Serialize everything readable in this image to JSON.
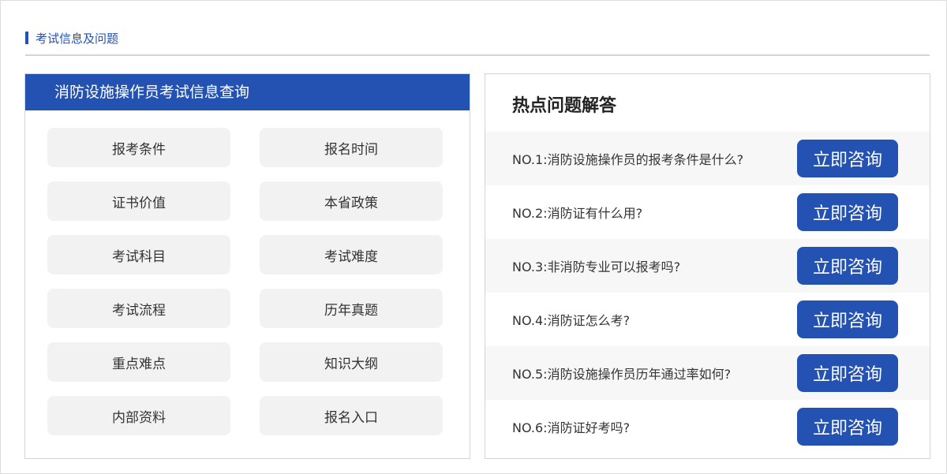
{
  "section": {
    "title": "考试信息及问题"
  },
  "left_panel": {
    "header": "消防设施操作员考试信息查询",
    "buttons": [
      "报考条件",
      "报名时间",
      "证书价值",
      "本省政策",
      "考试科目",
      "考试难度",
      "考试流程",
      "历年真题",
      "重点难点",
      "知识大纲",
      "内部资料",
      "报名入口"
    ]
  },
  "right_panel": {
    "title": "热点问题解答",
    "questions": [
      {
        "text": "NO.1:消防设施操作员的报考条件是什么?",
        "button": "立即咨询"
      },
      {
        "text": "NO.2:消防证有什么用?",
        "button": "立即咨询"
      },
      {
        "text": "NO.3:非消防专业可以报考吗?",
        "button": "立即咨询"
      },
      {
        "text": "NO.4:消防证怎么考?",
        "button": "立即咨询"
      },
      {
        "text": "NO.5:消防设施操作员历年通过率如何?",
        "button": "立即咨询"
      },
      {
        "text": "NO.6:消防证好考吗?",
        "button": "立即咨询"
      }
    ]
  },
  "colors": {
    "accent": "#2352b3",
    "button_bg": "#f2f2f2",
    "row_alt": "#f7f7f7"
  }
}
